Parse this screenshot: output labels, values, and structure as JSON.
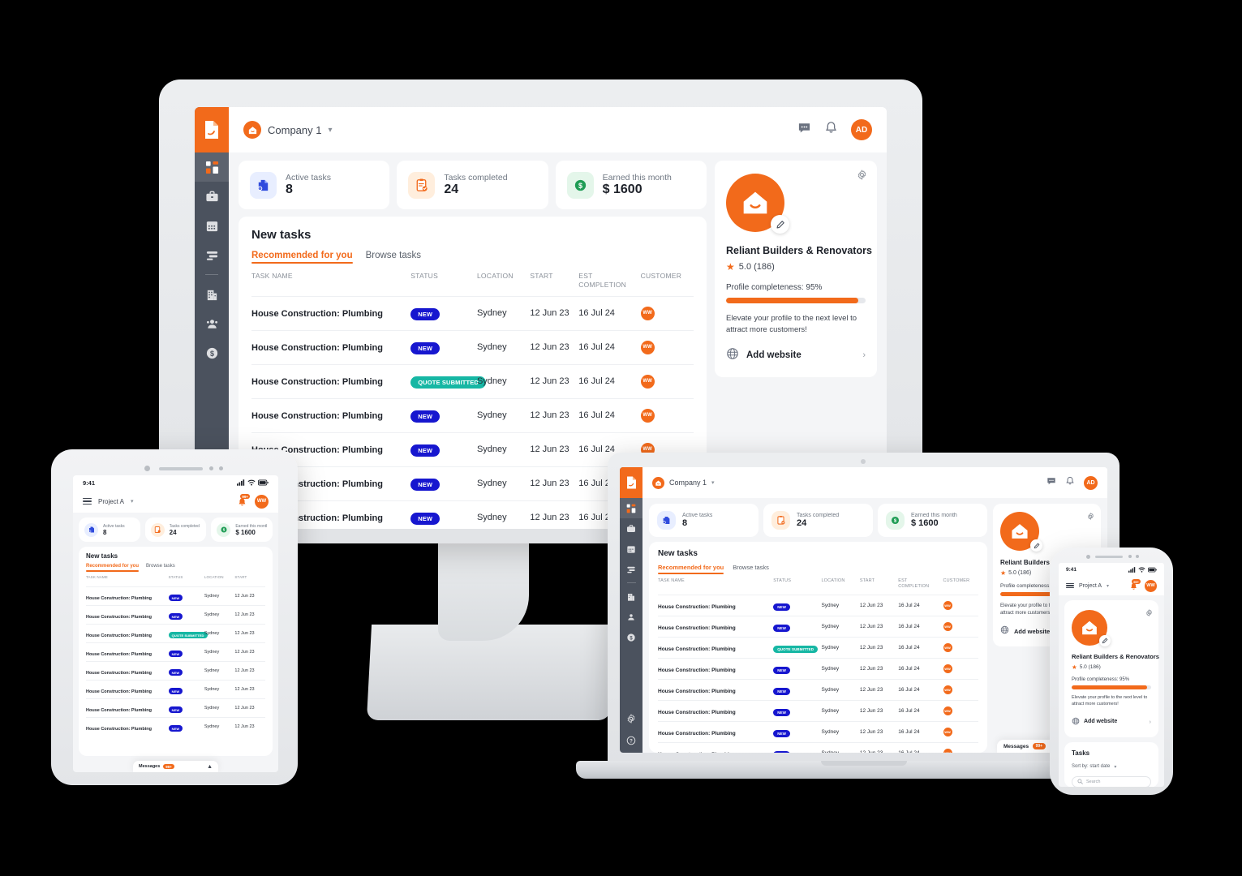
{
  "brand": {
    "orange": "#f26a1b",
    "rail": "#4b525e",
    "blue": "#1717cf",
    "teal": "#16b7a4",
    "green": "#1f9d55"
  },
  "app": {
    "company": "Company 1",
    "avatar_initials": "AD",
    "rail_items": [
      {
        "name": "dashboard",
        "label": "Dashboard"
      },
      {
        "name": "briefcase",
        "label": "Jobs"
      },
      {
        "name": "calendar",
        "label": "Calendar"
      },
      {
        "name": "tasks",
        "label": "Tasks"
      },
      {
        "name": "company",
        "label": "Company"
      },
      {
        "name": "team",
        "label": "Team"
      },
      {
        "name": "payments",
        "label": "Payments"
      }
    ],
    "rail_bottom": [
      {
        "name": "settings",
        "label": "Settings"
      },
      {
        "name": "help",
        "label": "Help"
      }
    ],
    "header_icons": [
      {
        "name": "messages",
        "label": "Messages"
      },
      {
        "name": "notifications",
        "label": "Notifications"
      }
    ],
    "stats": [
      {
        "label": "Active tasks",
        "value": "8",
        "icon": "document-icon"
      },
      {
        "label": "Tasks completed",
        "value": "24",
        "icon": "clipboard-check-icon"
      },
      {
        "label": "Earned this month",
        "value": "$ 1600",
        "icon": "dollar-icon"
      }
    ],
    "tasks_panel": {
      "title": "New tasks",
      "tabs": [
        {
          "label": "Recommended for you",
          "active": true
        },
        {
          "label": "Browse tasks",
          "active": false
        }
      ],
      "columns": [
        "TASK NAME",
        "STATUS",
        "LOCATION",
        "START",
        "EST COMPLETION",
        "CUSTOMER"
      ],
      "columns_tablet": [
        "TASK NAME",
        "STATUS",
        "LOCATION",
        "START"
      ],
      "rows": [
        {
          "task": "House Construction: Plumbing",
          "status": "NEW",
          "status_kind": "new",
          "location": "Sydney",
          "start": "12 Jun 23",
          "est": "16 Jul 24",
          "customer": "WW"
        },
        {
          "task": "House Construction: Plumbing",
          "status": "NEW",
          "status_kind": "new",
          "location": "Sydney",
          "start": "12 Jun 23",
          "est": "16 Jul 24",
          "customer": "WW"
        },
        {
          "task": "House Construction: Plumbing",
          "status": "QUOTE SUBMITTED",
          "status_kind": "quote",
          "location": "Sydney",
          "start": "12 Jun 23",
          "est": "16 Jul 24",
          "customer": "WW"
        },
        {
          "task": "House Construction: Plumbing",
          "status": "NEW",
          "status_kind": "new",
          "location": "Sydney",
          "start": "12 Jun 23",
          "est": "16 Jul 24",
          "customer": "WW"
        },
        {
          "task": "House Construction: Plumbing",
          "status": "NEW",
          "status_kind": "new",
          "location": "Sydney",
          "start": "12 Jun 23",
          "est": "16 Jul 24",
          "customer": "WW"
        },
        {
          "task": "House Construction: Plumbing",
          "status": "NEW",
          "status_kind": "new",
          "location": "Sydney",
          "start": "12 Jun 23",
          "est": "16 Jul 24",
          "customer": "WW"
        },
        {
          "task": "House Construction: Plumbing",
          "status": "NEW",
          "status_kind": "new",
          "location": "Sydney",
          "start": "12 Jun 23",
          "est": "16 Jul 24",
          "customer": "WW"
        },
        {
          "task": "House Construction: Plumbing",
          "status": "NEW",
          "status_kind": "new",
          "location": "Sydney",
          "start": "12 Jun 23",
          "est": "16 Jul 24",
          "customer": "WW"
        }
      ]
    },
    "profile": {
      "name": "Reliant Builders & Renovators",
      "rating": "5.0 (186)",
      "completeness_label": "Profile completeness: 95%",
      "completeness_percent": 95,
      "note": "Elevate your profile to the next level to attract more customers!",
      "action_label": "Add website",
      "action_icon": "globe-icon",
      "edit_icon": "pencil-icon",
      "settings_icon": "gear-icon"
    },
    "messages_bar": {
      "label": "Messages",
      "badge": "99+"
    }
  },
  "mobile": {
    "status_time": "9:41",
    "project": "Project A",
    "avatar_initials": "WW",
    "notif_badge": "99+",
    "tasks_card": {
      "title": "Tasks",
      "sort_label": "Sort by: start date",
      "search_placeholder": "Search"
    }
  }
}
